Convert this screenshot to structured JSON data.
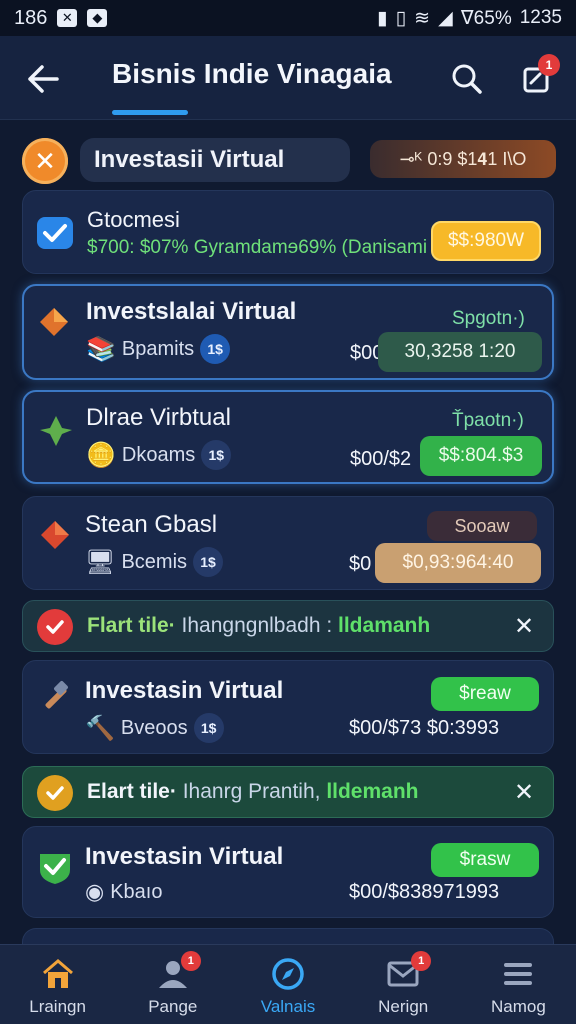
{
  "status_bar": {
    "left_text": "186",
    "right_text": "ᐁ65%",
    "time": "1235"
  },
  "app_bar": {
    "title": "Bisnis Indie Vinagaia",
    "notify_badge": "1"
  },
  "header": {
    "pill_label": "Investasii Virtual",
    "balance": "⊸ᴷ 0:9 $1𝟒1 I\\O"
  },
  "cards": [
    {
      "title": "Gtocmesi",
      "subtitle": "$700: $07% Gyramdamɘ69% (Danisami",
      "pill": "$$:980W"
    },
    {
      "title": "Investslalai Virtual",
      "tag": "Spgotn·)",
      "sub_label": "Bpamits",
      "sub_badge": "1$",
      "amount": "$00",
      "pill": "30,3258 1:20"
    },
    {
      "title": "Dlrae Virbtual",
      "tag": "Ťpaotn·)",
      "sub_label": "Dkoams",
      "sub_badge": "1$",
      "amount": "$00/$2",
      "pill": "$$:804.$3"
    },
    {
      "title": "Stean Gbasl",
      "tag": "Sooaw",
      "sub_label": "Bcemis",
      "sub_badge": "1$",
      "amount": "$0",
      "pill": "$0,93:964:40"
    },
    {
      "title": "Investasin Virtual",
      "tag": "$reaw",
      "sub_label": "Bveoos",
      "sub_badge": "1$",
      "amount": "$00/$73 $0:3993"
    },
    {
      "title": "Investasin Virtual",
      "tag": "$rasw",
      "sub_label": "Kbaıo",
      "amount": "$00/$838971993"
    }
  ],
  "toasts": [
    {
      "lead": "Flart tile·",
      "mid": "Ihangngnlbadh :",
      "tail": "lldamanh"
    },
    {
      "lead": "Elart tile·",
      "mid": "Ihanrg Prantih,",
      "tail": "lldemanh"
    }
  ],
  "bottom_nav": [
    {
      "label": "Lraingn",
      "icon": "home-icon"
    },
    {
      "label": "Pange",
      "icon": "user-icon",
      "badge": "1"
    },
    {
      "label": "Valnais",
      "icon": "compass-icon",
      "active": true
    },
    {
      "label": "Nerign",
      "icon": "mail-icon",
      "badge": "1"
    },
    {
      "label": "Namog",
      "icon": "menu-icon"
    }
  ],
  "colors": {
    "background": "#101a30",
    "card": "#19284a",
    "accent_blue": "#2f9cf0",
    "gold_pill": "#f7b928",
    "green_pill": "#32b24a",
    "tan_pill": "#c9a071",
    "green_text": "#5fe06a"
  }
}
